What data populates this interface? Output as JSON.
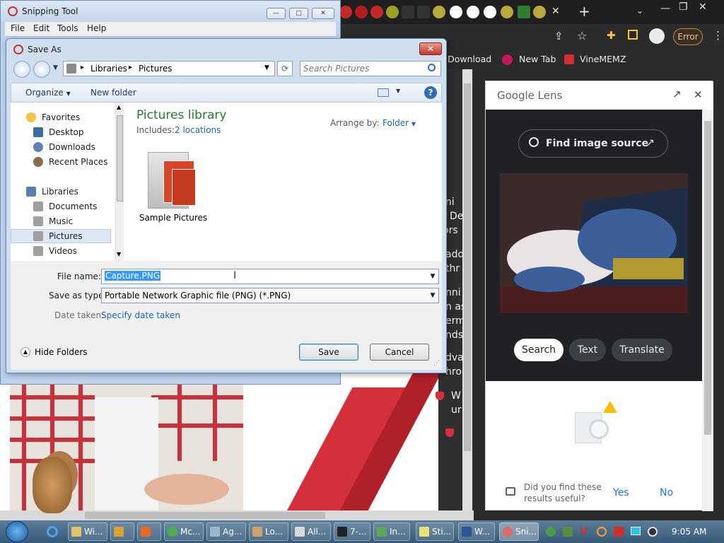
{
  "snipping_tool": {
    "title": "Snipping Tool",
    "menu": [
      "File",
      "Edit",
      "Tools",
      "Help"
    ],
    "window_buttons": {
      "minimize": "—",
      "maximize": "□",
      "close": "✕"
    }
  },
  "save_as": {
    "title": "Save As",
    "close_label": "✕",
    "breadcrumb": [
      "Libraries",
      "Pictures"
    ],
    "search_placeholder": "Search Pictures",
    "toolbar": {
      "organize": "Organize",
      "new_folder": "New folder",
      "help": "?"
    },
    "nav": {
      "favorites_header": "Favorites",
      "favorites": [
        "Desktop",
        "Downloads",
        "Recent Places"
      ],
      "libraries_header": "Libraries",
      "libraries": [
        "Documents",
        "Music",
        "Pictures",
        "Videos"
      ],
      "selected": "Pictures"
    },
    "content": {
      "library_title": "Pictures library",
      "includes_label": "Includes:",
      "includes_link": "2 locations",
      "arrange_label": "Arrange by:",
      "arrange_value": "Folder",
      "items": [
        {
          "name": "Sample Pictures"
        }
      ]
    },
    "form": {
      "file_name_label": "File name:",
      "file_name_value": "Capture.PNG",
      "save_type_label": "Save as type:",
      "save_type_value": "Portable Network Graphic file (PNG) (*.PNG)",
      "date_taken_label": "Date taken:",
      "date_taken_link": "Specify date taken"
    },
    "hide_folders": "Hide Folders",
    "save_button": "Save",
    "cancel_button": "Cancel"
  },
  "browser": {
    "bookmarks": [
      "r Download",
      "New Tab",
      "VineMEMZ"
    ],
    "error_badge": "Error",
    "page_text": [
      "ini",
      "De",
      "ors",
      "add",
      "thr",
      "nni",
      "n as",
      "erm",
      "nds",
      "dva",
      "hro",
      "W",
      "ur"
    ]
  },
  "lens": {
    "brand": "Google Lens",
    "find_source": "Find image source",
    "tabs": [
      "Search",
      "Text",
      "Translate"
    ],
    "active_tab": "Search",
    "feedback_question": "Did you find these results useful?",
    "yes": "Yes",
    "no": "No"
  },
  "taskbar": {
    "items": [
      "Wi...",
      "Mc...",
      "Ag...",
      "Lo...",
      "All...",
      "7-...",
      "In...",
      "Sti...",
      "W...",
      "Sni..."
    ],
    "clock": "9:05 AM"
  },
  "colors": {
    "win7_blue": "#cfdff0",
    "library_green": "#1e7d2e",
    "link_blue": "#1a64b5",
    "lens_dark": "#202124",
    "lens_accent": "#8ab4f8",
    "brand_red": "#d4303b"
  }
}
